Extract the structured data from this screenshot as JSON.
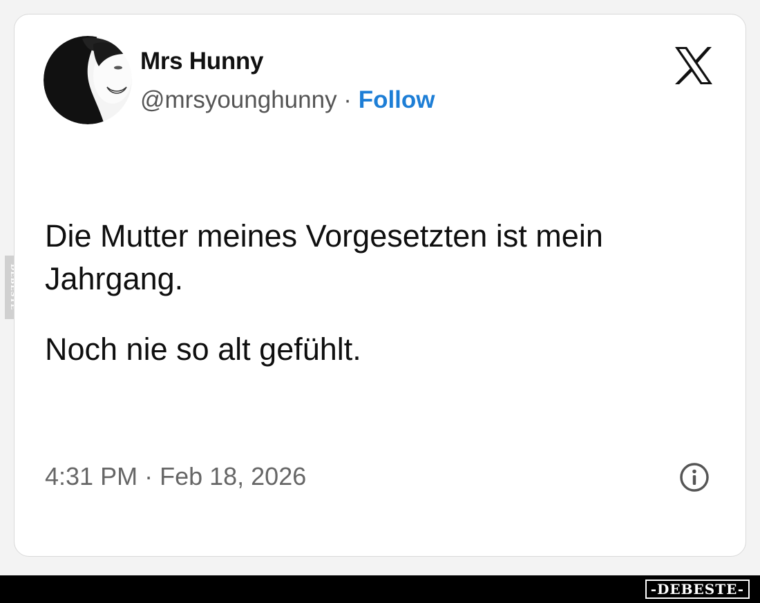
{
  "tweet": {
    "author_name": "Mrs Hunny",
    "handle": "@mrsyounghunny",
    "separator": " · ",
    "follow_label": "Follow",
    "paragraphs": [
      "Die Mutter meines Vorgesetzten ist mein Jahrgang.",
      "Noch nie so alt gefühlt."
    ],
    "time": "4:31 PM",
    "meta_separator": " · ",
    "date": "Feb 18, 2026"
  },
  "icons": {
    "platform": "x-logo-icon",
    "info": "info-icon",
    "avatar": "avatar"
  },
  "watermark": {
    "side_text": "DEBESTE",
    "brand_text": "-DEBESTE-"
  },
  "colors": {
    "follow": "#1d7ed6",
    "card_bg": "#ffffff",
    "bottom_bar": "#000000"
  }
}
